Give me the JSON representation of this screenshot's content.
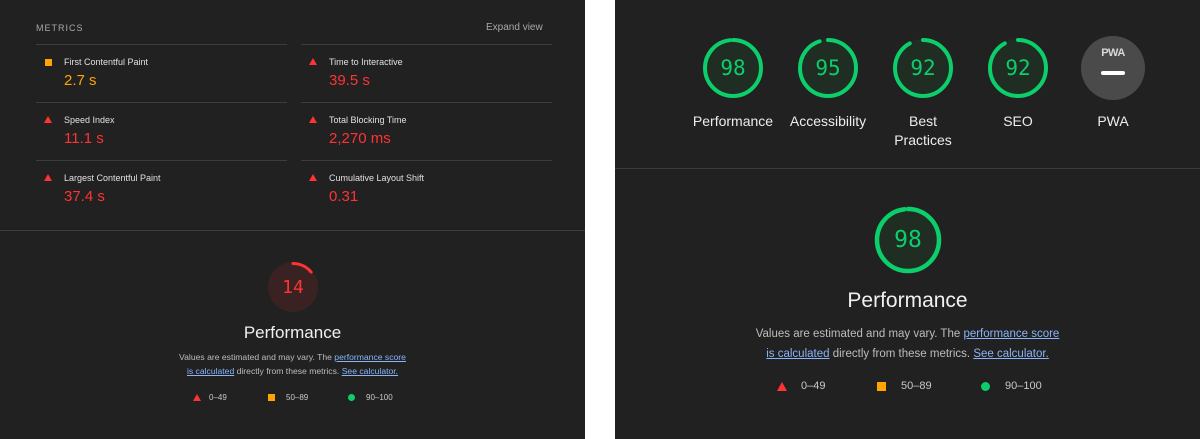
{
  "left": {
    "metrics_title": "METRICS",
    "expand_view": "Expand view",
    "metrics": [
      {
        "label": "First Contentful Paint",
        "value": "2.7 s",
        "rating": "average",
        "color": "#ffa400"
      },
      {
        "label": "Time to Interactive",
        "value": "39.5 s",
        "rating": "fail",
        "color": "#ff3333"
      },
      {
        "label": "Speed Index",
        "value": "11.1 s",
        "rating": "fail",
        "color": "#ff3333"
      },
      {
        "label": "Total Blocking Time",
        "value": "2,270 ms",
        "rating": "fail",
        "color": "#ff3333"
      },
      {
        "label": "Largest Contentful Paint",
        "value": "37.4 s",
        "rating": "fail",
        "color": "#ff3333"
      },
      {
        "label": "Cumulative Layout Shift",
        "value": "0.31",
        "rating": "fail",
        "color": "#ff3333"
      }
    ],
    "score": {
      "value": "14",
      "fraction": 0.14,
      "color": "#ff3333"
    },
    "perf_title": "Performance",
    "desc": {
      "prefix": "Values are estimated and may vary. The ",
      "link1a": "performance score",
      "link1b": "is calculated",
      "mid": " directly from these metrics. ",
      "link2": "See calculator."
    },
    "legend": [
      {
        "label": "0–49",
        "shape": "triangle",
        "color": "#ff3333"
      },
      {
        "label": "50–89",
        "shape": "square",
        "color": "#ffa400"
      },
      {
        "label": "90–100",
        "shape": "circle",
        "color": "#0cce6b"
      }
    ]
  },
  "right": {
    "categories": [
      {
        "name": "Performance",
        "score": "98",
        "fraction": 0.98
      },
      {
        "name": "Accessibility",
        "score": "95",
        "fraction": 0.95
      },
      {
        "name": "Best Practices",
        "score": "92",
        "fraction": 0.92
      },
      {
        "name": "SEO",
        "score": "92",
        "fraction": 0.92
      }
    ],
    "pwa": {
      "badge": "PWA",
      "name": "PWA"
    },
    "main_score": {
      "value": "98",
      "fraction": 0.98
    },
    "perf_title": "Performance",
    "desc": {
      "prefix": "Values are estimated and may vary. The ",
      "link1a": "performance score",
      "link1b": "is calculated",
      "mid": " directly from these metrics. ",
      "link2": "See calculator."
    },
    "legend": [
      {
        "label": "0–49",
        "shape": "triangle",
        "color": "#ff3333"
      },
      {
        "label": "50–89",
        "shape": "square",
        "color": "#ffa400"
      },
      {
        "label": "90–100",
        "shape": "circle",
        "color": "#0cce6b"
      }
    ],
    "pass_color": "#0cce6b"
  }
}
